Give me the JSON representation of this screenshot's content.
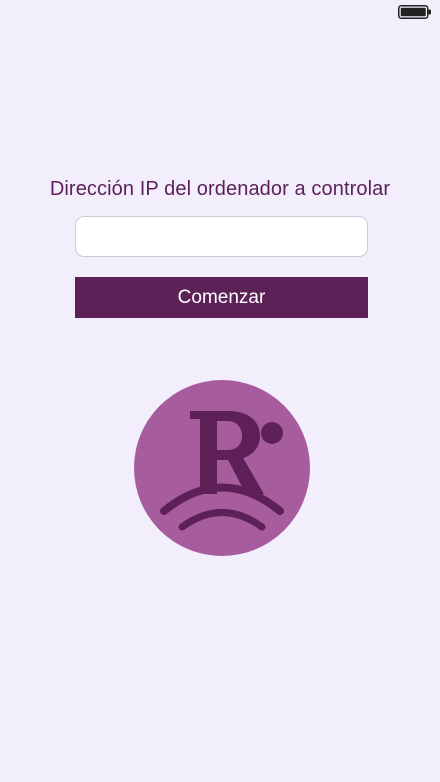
{
  "status_bar": {
    "battery_icon": "battery-full-icon"
  },
  "form": {
    "prompt": "Dirección IP del ordenador a controlar",
    "ip_value": "",
    "ip_placeholder": "",
    "start_label": "Comenzar"
  },
  "logo": {
    "icon": "app-logo-r-bridge",
    "circle_color": "#a75c9e",
    "mark_color": "#5e2157"
  },
  "colors": {
    "background": "#f3eefc",
    "accent": "#5e2157",
    "text": "#5c2159"
  }
}
